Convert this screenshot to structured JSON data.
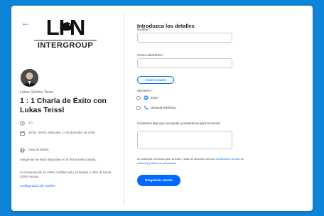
{
  "colors": {
    "background": "#0e84d8",
    "accent": "#0069ff",
    "card": "#ffffff"
  },
  "icons": {
    "back": "arrow-left-icon",
    "duration": "clock-icon",
    "date": "calendar-icon",
    "timezone": "globe-icon",
    "zoom": "zoom-icon",
    "phone": "phone-icon"
  },
  "brand": {
    "logo_big": "LI   N",
    "logo_sub": "INTERGROUP"
  },
  "event": {
    "host": "Lukas Günther Teissl",
    "title": "1 : 1 Charla de Éxito con Lukas Teissl",
    "duration": "1 h",
    "datetime": "18:00 - 19:00, miércoles, 17 de diciembre de 2025",
    "timezone": "Hora de Bolivia",
    "note1": "Asegúrese de estar disponible en la fecha seleccionada.",
    "note2": "La conversación es 100% confidencial y se llevará a cabo de forma 100% remota.",
    "cookie_link": "Configuración de cookies"
  },
  "form": {
    "title": "Introduzca los detalles",
    "name_label": "Nombre *",
    "email_label": "Correo electrónico *",
    "add_guests": "Añadir invitados",
    "location_label": "Ubicación *",
    "location_options": [
      "Zoom",
      "Llamada telefónica"
    ],
    "message_label": "Cuéntenos algo que nos ayude a prepararnos para la reunión",
    "legal_prefix": "Al continuar, confirma que ha leído y está de acuerdo con los",
    "legal_link1": "Condiciones de uso de Calendly",
    "legal_mid": "y",
    "legal_link2": "Aviso de privacidad.",
    "submit": "Programar evento"
  }
}
